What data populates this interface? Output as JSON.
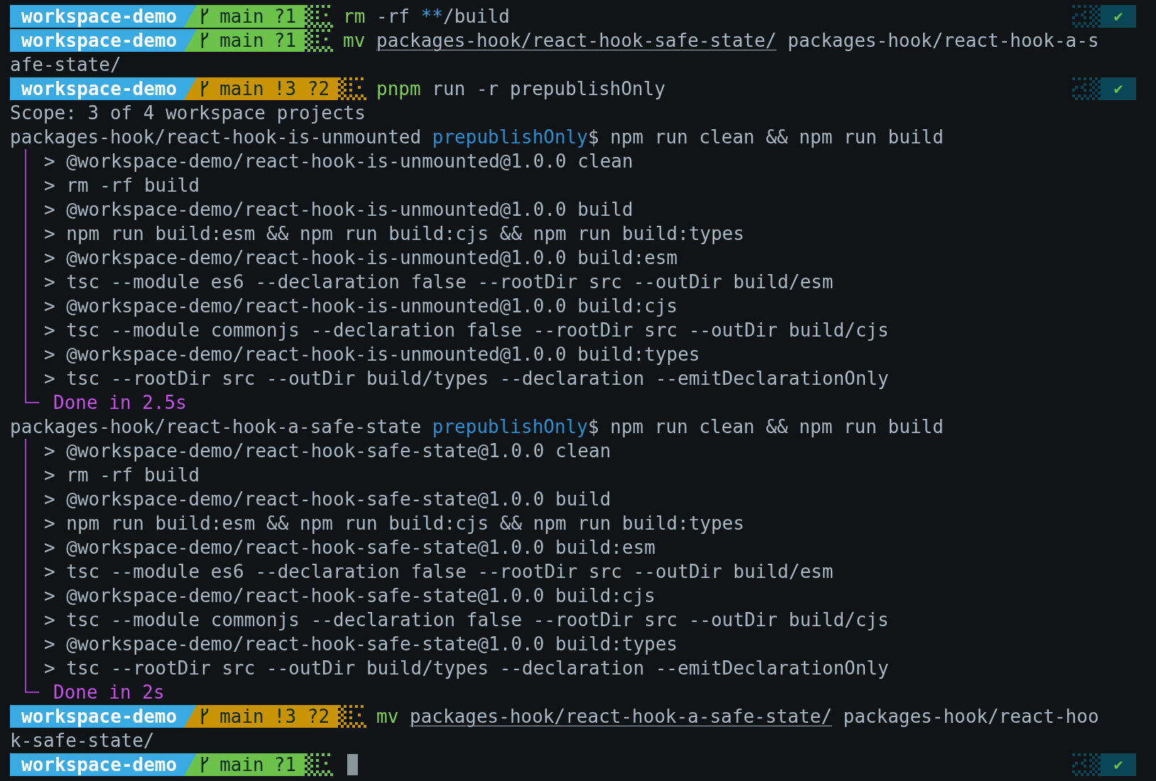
{
  "terminal": {
    "lines": [
      {
        "kind": "prompt",
        "dir": "workspace-demo",
        "branch": {
          "name": "main",
          "status": "?1",
          "color": "#6cc24a"
        },
        "command": [
          {
            "kind": "program",
            "text": "rm"
          },
          {
            "kind": "plain",
            "text": " -rf "
          },
          {
            "kind": "glob",
            "text": "**"
          },
          {
            "kind": "plain",
            "text": "/build"
          }
        ],
        "status": "✔"
      },
      {
        "kind": "prompt",
        "dir": "workspace-demo",
        "branch": {
          "name": "main",
          "status": "?1",
          "color": "#6cc24a"
        },
        "command": [
          {
            "kind": "program",
            "text": "mv "
          },
          {
            "kind": "path",
            "text": "packages-hook/react-hook-safe-state/"
          },
          {
            "kind": "plain",
            "text": " packages-hook/react-hook-a-s"
          }
        ]
      },
      {
        "kind": "text",
        "text": "afe-state/"
      },
      {
        "kind": "prompt",
        "dir": "workspace-demo",
        "branch": {
          "name": "main",
          "status": "!3 ?2",
          "color": "#c99400"
        },
        "command": [
          {
            "kind": "program",
            "text": "pnpm"
          },
          {
            "kind": "plain",
            "text": " run -r prepublishOnly"
          }
        ],
        "status": "✔"
      },
      {
        "kind": "text",
        "text": "Scope: 3 of 4 workspace projects"
      },
      {
        "kind": "run",
        "path": "packages-hook/react-hook-is-unmounted",
        "script": "prepublishOnly",
        "command": "$ npm run clean && npm run build"
      },
      {
        "kind": "group",
        "items": [
          "> @workspace-demo/react-hook-is-unmounted@1.0.0 clean",
          "> rm -rf build",
          "> @workspace-demo/react-hook-is-unmounted@1.0.0 build",
          "> npm run build:esm && npm run build:cjs && npm run build:types",
          "> @workspace-demo/react-hook-is-unmounted@1.0.0 build:esm",
          "> tsc --module es6 --declaration false --rootDir src --outDir build/esm",
          "> @workspace-demo/react-hook-is-unmounted@1.0.0 build:cjs",
          "> tsc --module commonjs --declaration false --rootDir src --outDir build/cjs",
          "> @workspace-demo/react-hook-is-unmounted@1.0.0 build:types",
          "> tsc --rootDir src --outDir build/types --declaration --emitDeclarationOnly"
        ],
        "footer": "Done in 2.5s"
      },
      {
        "kind": "run",
        "path": "packages-hook/react-hook-a-safe-state",
        "script": "prepublishOnly",
        "command": "$ npm run clean && npm run build"
      },
      {
        "kind": "group",
        "items": [
          "> @workspace-demo/react-hook-safe-state@1.0.0 clean",
          "> rm -rf build",
          "> @workspace-demo/react-hook-safe-state@1.0.0 build",
          "> npm run build:esm && npm run build:cjs && npm run build:types",
          "> @workspace-demo/react-hook-safe-state@1.0.0 build:esm",
          "> tsc --module es6 --declaration false --rootDir src --outDir build/esm",
          "> @workspace-demo/react-hook-safe-state@1.0.0 build:cjs",
          "> tsc --module commonjs --declaration false --rootDir src --outDir build/cjs",
          "> @workspace-demo/react-hook-safe-state@1.0.0 build:types",
          "> tsc --rootDir src --outDir build/types --declaration --emitDeclarationOnly"
        ],
        "footer": "Done in 2s"
      },
      {
        "kind": "prompt",
        "dir": "workspace-demo",
        "branch": {
          "name": "main",
          "status": "!3 ?2",
          "color": "#c99400"
        },
        "command": [
          {
            "kind": "program",
            "text": "mv "
          },
          {
            "kind": "path",
            "text": "packages-hook/react-hook-a-safe-state/"
          },
          {
            "kind": "plain",
            "text": " packages-hook/react-hoo"
          }
        ]
      },
      {
        "kind": "text",
        "text": "k-safe-state/"
      },
      {
        "kind": "prompt",
        "dir": "workspace-demo",
        "branch": {
          "name": "main",
          "status": "?1",
          "color": "#6cc24a"
        },
        "status": "✔",
        "cursor": true
      }
    ]
  }
}
